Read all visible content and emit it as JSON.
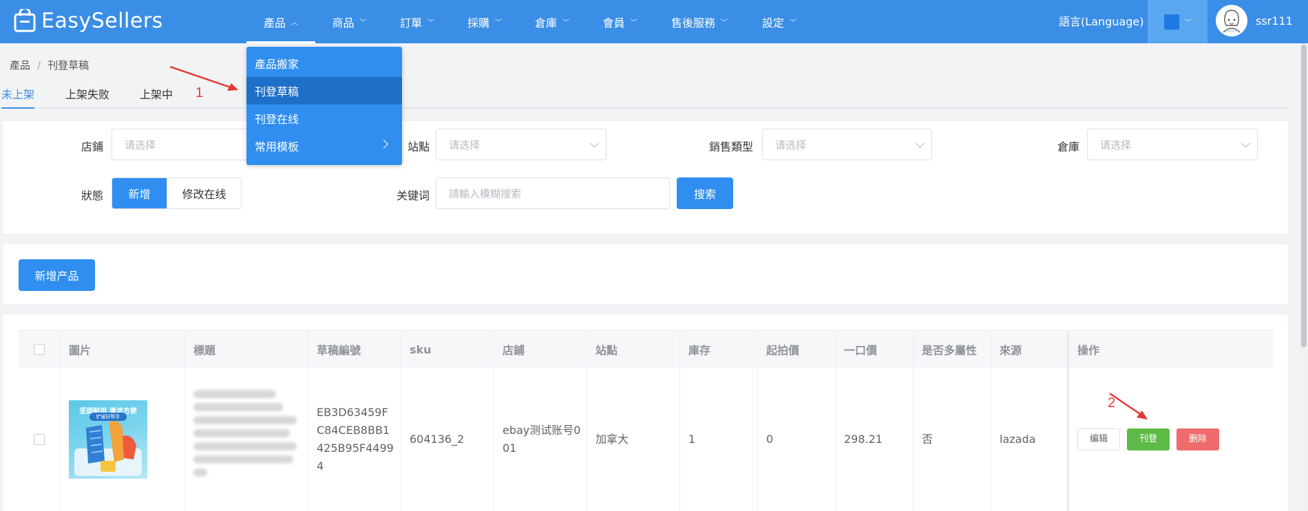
{
  "app": {
    "logo_text": "EasySellers"
  },
  "nav": [
    {
      "label": "產品",
      "name": "nav-products",
      "active": true
    },
    {
      "label": "商品"
    },
    {
      "label": "訂單"
    },
    {
      "label": "採購"
    },
    {
      "label": "倉庫"
    },
    {
      "label": "會員"
    },
    {
      "label": "售後服務"
    },
    {
      "label": "設定"
    }
  ],
  "header": {
    "language": "語言(Language)",
    "username": "ssr111"
  },
  "breadcrumb": {
    "root": "產品",
    "separator": "/",
    "current": "刊登草稿"
  },
  "tabs": [
    "未上架",
    "上架失败",
    "上架中"
  ],
  "dropdown": {
    "items": [
      "產品搬家",
      "刊登草稿",
      "刊登在线",
      "常用模板"
    ],
    "highlighted_index": 1
  },
  "annotations": {
    "one": "1",
    "two": "2"
  },
  "filters": {
    "store_label": "店鋪",
    "site_label": "站點",
    "sale_type_label": "銷售類型",
    "warehouse_label": "倉庫",
    "select_placeholder": "请选择",
    "status_label": "狀態",
    "status_options": [
      "新增",
      "修改在线"
    ],
    "status_selected": "新增",
    "keyword_label": "关键词",
    "keyword_placeholder": "請輸入模糊搜索",
    "search_button": "搜索"
  },
  "actions": {
    "add_product": "新增产品"
  },
  "table": {
    "headers": [
      "圖片",
      "標題",
      "草稿編號",
      "sku",
      "店鋪",
      "站點",
      "庫存",
      "起拍價",
      "一口價",
      "是否多屬性",
      "來源",
      "操作"
    ],
    "rows": [
      {
        "image_text_top": "坚固耐用 清洁方便",
        "image_text_sub": "铲屎好帮手",
        "draft_id": "EB3D63459FC84CEB8BB1425B95F44994",
        "sku": "604136_2",
        "store": "ebay测试账号001",
        "site": "加拿大",
        "stock": "1",
        "start_price": "0",
        "buy_now_price": "298.21",
        "multi_attr": "否",
        "source": "lazada",
        "edit_label": "编辑",
        "publish_label": "刊登",
        "delete_label": "删除"
      }
    ]
  },
  "colors": {
    "header_bg": "#3a8ee6",
    "primary": "#2f8ef0",
    "success": "#5dbb46",
    "danger": "#f06b6b",
    "annotation": "#e53935"
  }
}
